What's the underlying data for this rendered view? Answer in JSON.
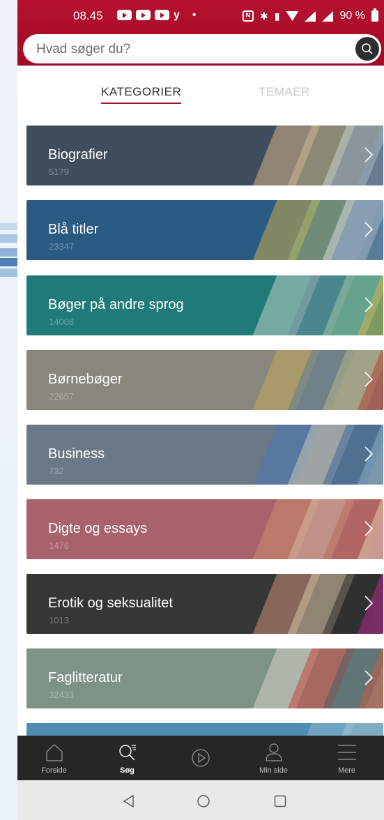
{
  "status_bar": {
    "time": "08.45",
    "battery": "90 %"
  },
  "search": {
    "placeholder": "Hvad søger du?"
  },
  "tabs": [
    {
      "label": "KATEGORIER",
      "active": true
    },
    {
      "label": "TEMAER",
      "active": false
    }
  ],
  "categories": [
    {
      "name": "Biografier",
      "count": "5179",
      "color": "#3f4d5c"
    },
    {
      "name": "Blå titler",
      "count": "23347",
      "color": "#2a5a82"
    },
    {
      "name": "Bøger på andre sprog",
      "count": "14008",
      "color": "#1f7a78"
    },
    {
      "name": "Børnebøger",
      "count": "22657",
      "color": "#87877d"
    },
    {
      "name": "Business",
      "count": "732",
      "color": "#6b7987"
    },
    {
      "name": "Digte og essays",
      "count": "1476",
      "color": "#a8626c"
    },
    {
      "name": "Erotik og seksualitet",
      "count": "1013",
      "color": "#363636"
    },
    {
      "name": "Faglitteratur",
      "count": "32433",
      "color": "#7e9386"
    },
    {
      "name": "",
      "count": "",
      "color": "#4f8eb0"
    }
  ],
  "bottom_nav": [
    {
      "label": "Forside",
      "icon": "home-icon",
      "active": false
    },
    {
      "label": "Søg",
      "icon": "search-icon",
      "active": true
    },
    {
      "label": "",
      "icon": "play-icon",
      "active": false
    },
    {
      "label": "Min side",
      "icon": "user-icon",
      "active": false
    },
    {
      "label": "Mere",
      "icon": "menu-icon",
      "active": false
    }
  ],
  "colors": {
    "brand": "#a8122e",
    "nav_bg": "#262626"
  }
}
